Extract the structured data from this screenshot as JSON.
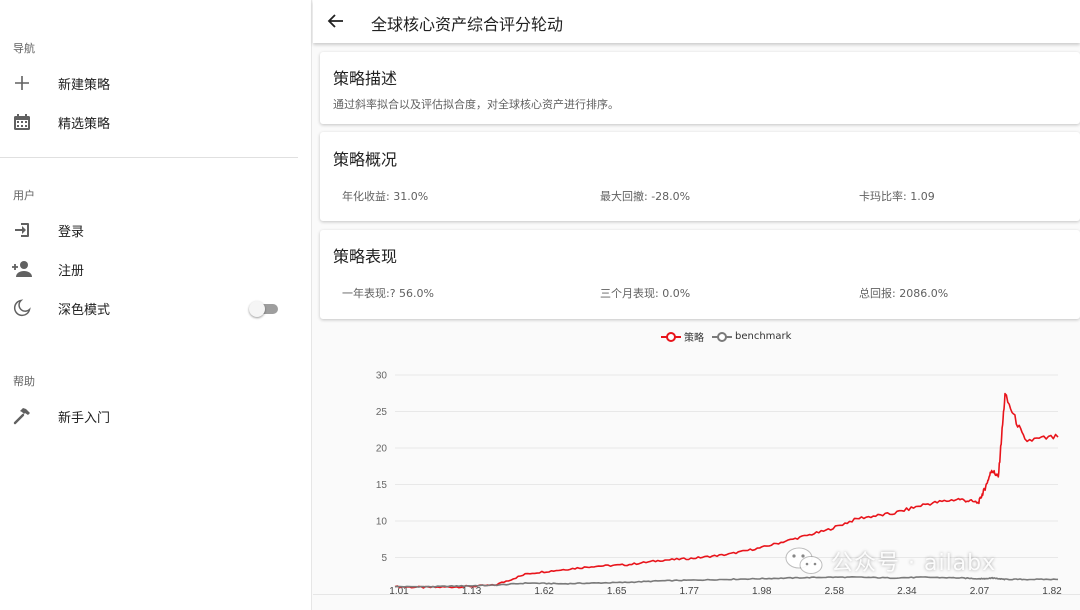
{
  "sidebar": {
    "sections": [
      {
        "title": "导航",
        "items": [
          {
            "label": "新建策略",
            "icon": "plus-icon"
          },
          {
            "label": "精选策略",
            "icon": "calendar-icon"
          }
        ]
      },
      {
        "title": "用户",
        "items": [
          {
            "label": "登录",
            "icon": "login-icon"
          },
          {
            "label": "注册",
            "icon": "person-add-icon"
          },
          {
            "label": "深色模式",
            "icon": "moon-icon",
            "toggle": false
          }
        ]
      },
      {
        "title": "帮助",
        "items": [
          {
            "label": "新手入门",
            "icon": "hammer-icon"
          }
        ]
      }
    ]
  },
  "topbar": {
    "title": "全球核心资产综合评分轮动",
    "back_icon": "arrow-left-icon"
  },
  "description_card": {
    "title": "策略描述",
    "text": "通过斜率拟合以及评估拟合度，对全球核心资产进行排序。"
  },
  "overview_card": {
    "title": "策略概况",
    "stats": [
      "年化收益: 31.0%",
      "最大回撤: -28.0%",
      "卡玛比率: 1.09"
    ]
  },
  "performance_card": {
    "title": "策略表现",
    "stats": [
      "一年表现:? 56.0%",
      "三个月表现: 0.0%",
      "总回报: 2086.0%"
    ]
  },
  "chart_data": {
    "type": "line",
    "legend": [
      "策略",
      "benchmark"
    ],
    "y_ticks": [
      "5",
      "10",
      "15",
      "20",
      "25",
      "30"
    ],
    "ylim": [
      0,
      30
    ],
    "x_tick_labels": [
      "1.01",
      "1.13",
      "1.62",
      "1.65",
      "1.77",
      "1.98",
      "2.58",
      "2.34",
      "2.07",
      "1.82"
    ],
    "x": [
      0,
      5,
      10,
      15,
      20,
      25,
      30,
      35,
      40,
      45,
      50,
      55,
      60,
      65,
      70,
      75,
      80,
      85,
      88,
      89,
      90,
      91,
      92,
      95,
      100
    ],
    "series": [
      {
        "name": "策略",
        "color": "#e8141b",
        "values": [
          1.0,
          0.9,
          1.0,
          1.2,
          2.8,
          3.3,
          3.8,
          4.0,
          4.6,
          4.9,
          5.4,
          6.3,
          7.5,
          8.7,
          10.4,
          11.0,
          12.3,
          13.0,
          12.5,
          14.5,
          17.0,
          16.0,
          27.2,
          21.0,
          21.5
        ]
      },
      {
        "name": "benchmark",
        "color": "#7a7a7a",
        "values": [
          1.0,
          1.0,
          1.1,
          1.2,
          1.5,
          1.4,
          1.5,
          1.6,
          1.8,
          1.9,
          2.0,
          2.1,
          2.2,
          2.3,
          2.3,
          2.2,
          2.3,
          2.2,
          2.1,
          2.1,
          2.2,
          2.1,
          2.0,
          2.0,
          2.0
        ]
      }
    ],
    "grid": true
  },
  "watermark": {
    "text": "公众号 · ailabx",
    "icon": "wechat-icon"
  }
}
